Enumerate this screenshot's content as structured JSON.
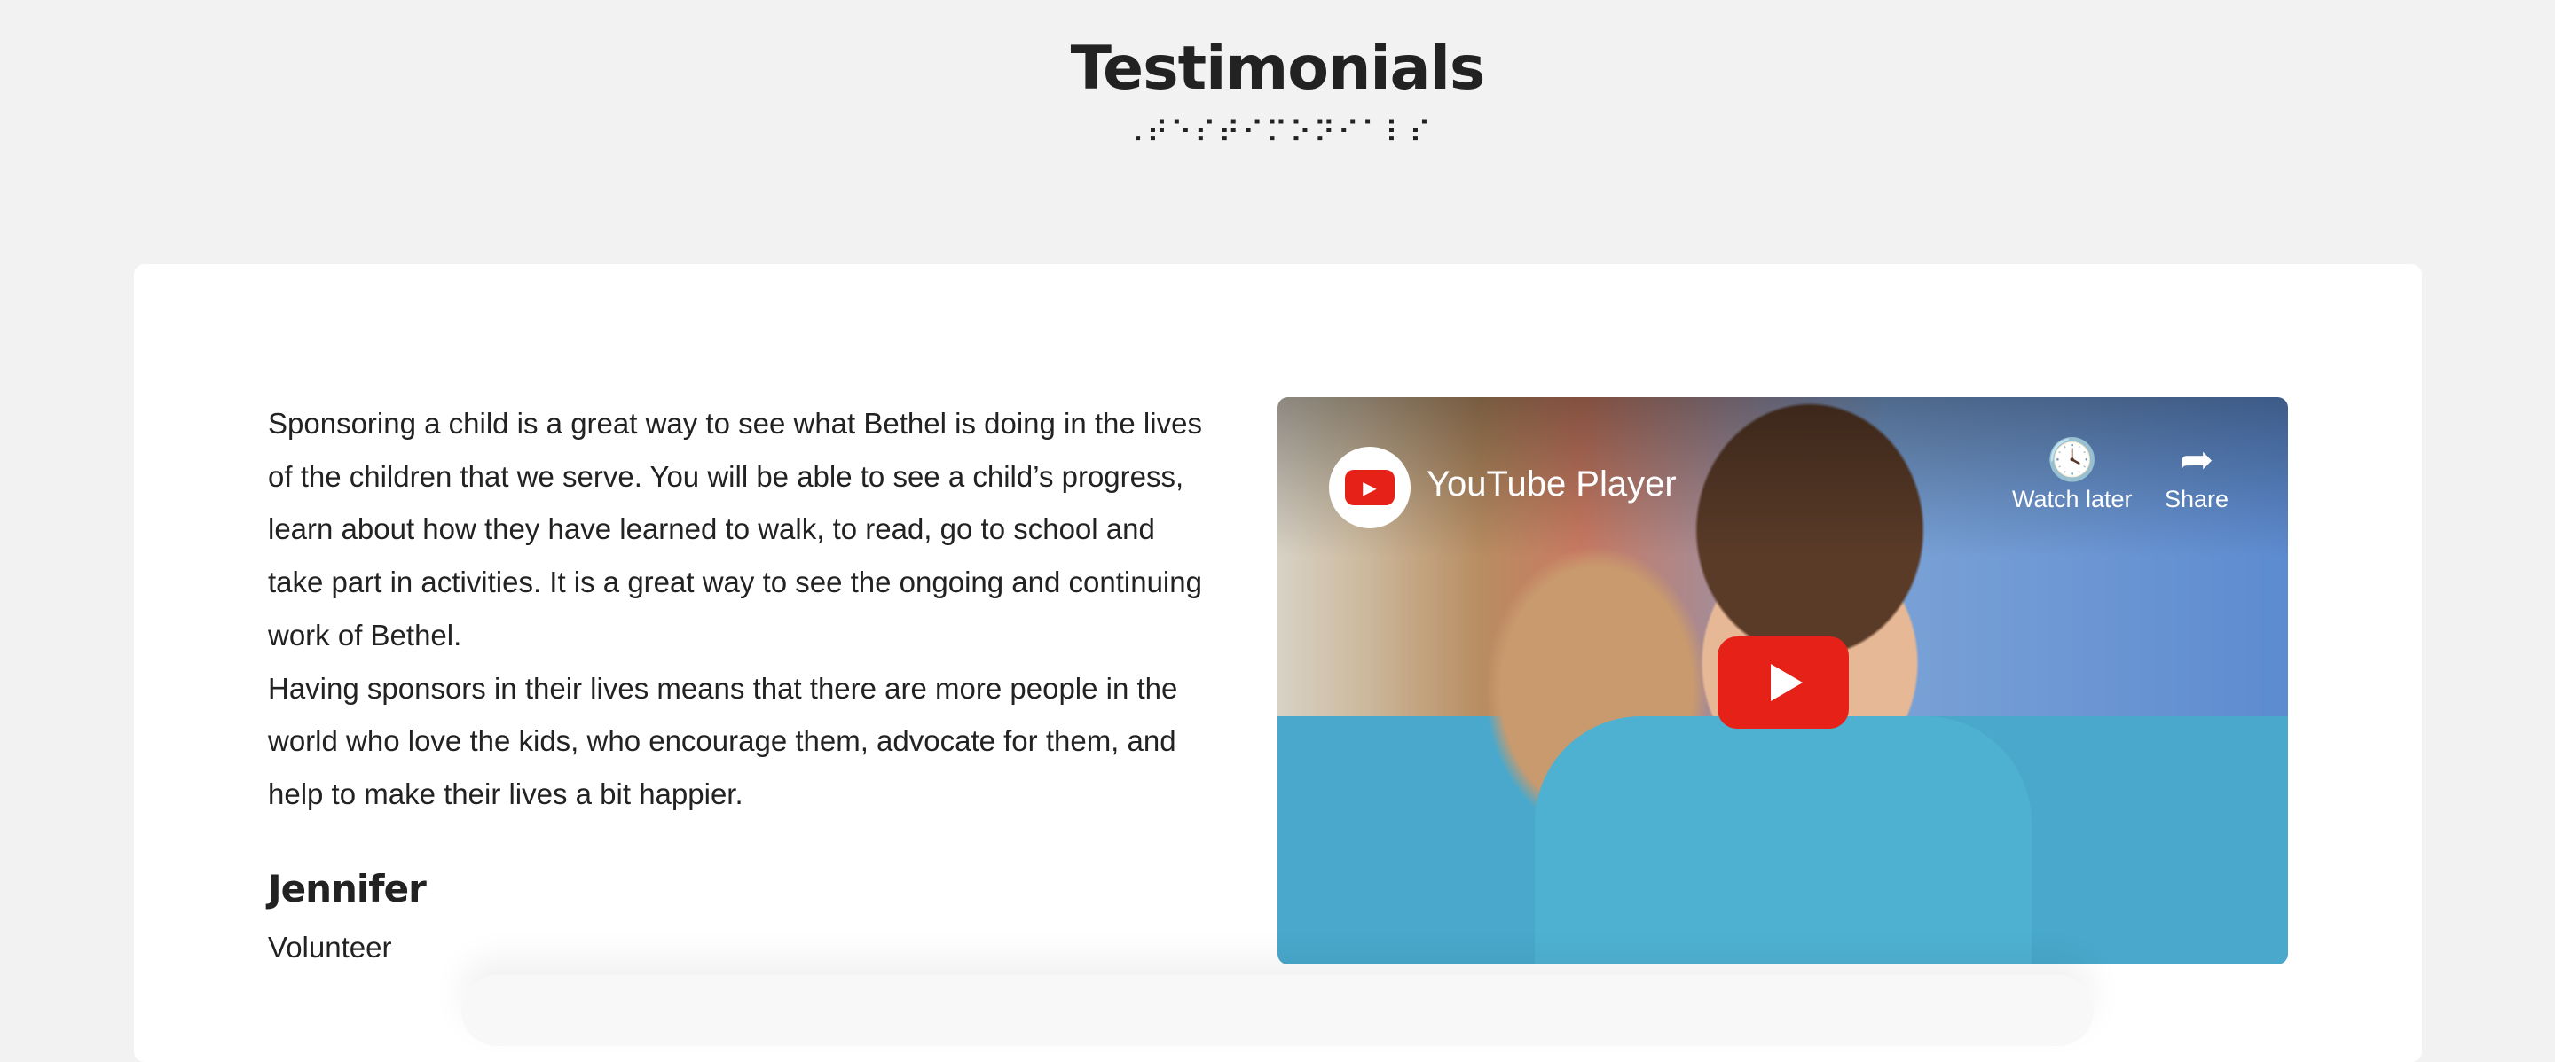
{
  "header": {
    "title": "Testimonials",
    "braille": "⠠⠞⠑⠎⠞⠊⠍⠕⠝⠊⠁⠇⠎"
  },
  "testimonial": {
    "paragraphs": [
      "Sponsoring a child is a great way to see what Bethel is doing in the lives of the children that we serve. You will be able to see a child’s progress, learn about how they have learned to walk, to read, go to school and take part in activities. It is a great way to see the ongoing and continuing work of Bethel.",
      "Having sponsors in their lives means that there are more people in the world who love the kids, who encourage them, advocate for them, and help to make their lives a bit happier."
    ],
    "name": "Jennifer",
    "role": "Volunteer"
  },
  "video": {
    "player_title": "YouTube Player",
    "watch_later": "Watch later",
    "share": "Share",
    "icons": {
      "watch_later": "clock-icon",
      "share": "share-arrow-icon",
      "play": "play-icon"
    },
    "accent": "#e62117"
  }
}
